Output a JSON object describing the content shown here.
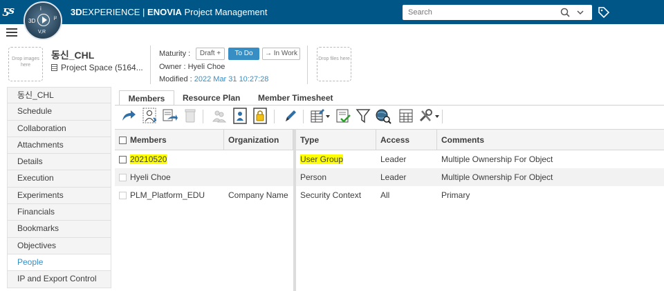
{
  "app": {
    "brand": "3D",
    "brand_rest": "EXPERIENCE",
    "module": "ENOVIA",
    "title": "Project Management",
    "search_placeholder": "Search",
    "compass": {
      "top": "i",
      "left": "3D",
      "right": "i²",
      "bottom": "V,R"
    }
  },
  "header": {
    "drop_images": "Drop images here",
    "object_title": "동신_CHL",
    "object_type": "Project Space (5164...",
    "maturity_label": "Maturity :",
    "maturity_states": [
      {
        "label": "Draft +",
        "active": false
      },
      {
        "label": "To Do",
        "active": true
      },
      {
        "label": "→ In Work",
        "active": false
      }
    ],
    "owner": "Owner : Hyeli Choe",
    "modified_label": "Modified : ",
    "modified_value": "2022 Mar 31 10:27:28",
    "drop_files": "Drop files here"
  },
  "sidebar": {
    "items": [
      {
        "label": "동신_CHL"
      },
      {
        "label": "Schedule"
      },
      {
        "label": "Collaboration"
      },
      {
        "label": "Attachments"
      },
      {
        "label": "Details"
      },
      {
        "label": "Execution"
      },
      {
        "label": "Experiments"
      },
      {
        "label": "Financials"
      },
      {
        "label": "Bookmarks"
      },
      {
        "label": "Objectives"
      },
      {
        "label": "People",
        "active": true
      },
      {
        "label": "IP and Export Control"
      }
    ]
  },
  "tabs": [
    {
      "label": "Members",
      "active": true
    },
    {
      "label": "Resource Plan"
    },
    {
      "label": "Member Timesheet"
    }
  ],
  "table": {
    "left_headers": [
      "Members",
      "Organization"
    ],
    "right_headers": [
      "Type",
      "Access",
      "Comments"
    ],
    "rows": [
      {
        "member": "20210520",
        "organization": "",
        "type": "User Group",
        "access": "Leader",
        "comments": "Multiple Ownership For Object",
        "highlighted": true
      },
      {
        "member": "Hyeli Choe",
        "organization": "",
        "type": "Person",
        "access": "Leader",
        "comments": "Multiple Ownership For Object"
      },
      {
        "member": "PLM_Platform_EDU",
        "organization": "Company Name",
        "type": "Security Context",
        "access": "All",
        "comments": "Primary"
      }
    ]
  },
  "colors": {
    "topbar": "#005686",
    "accent": "#368ec4",
    "highlight": "#ffff00"
  }
}
